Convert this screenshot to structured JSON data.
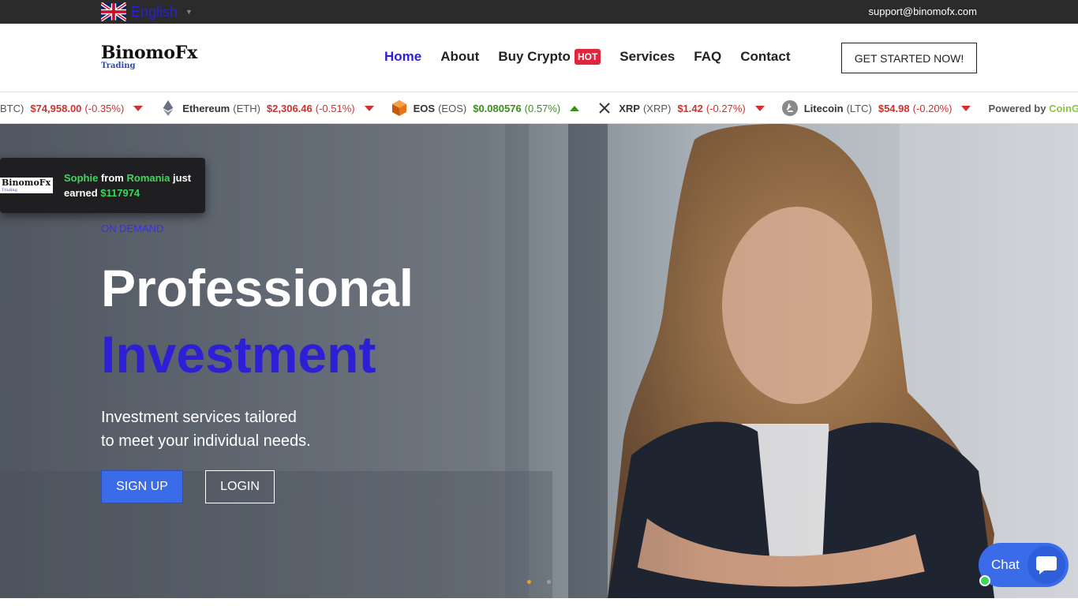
{
  "topbar": {
    "language": "English",
    "support_email": "support@binomofx.com"
  },
  "brand": {
    "name": "BinomoFx",
    "tagline": "Trading"
  },
  "nav": {
    "items": [
      {
        "label": "Home",
        "active": true
      },
      {
        "label": "About"
      },
      {
        "label": "Buy Crypto",
        "badge": "HOT"
      },
      {
        "label": "Services"
      },
      {
        "label": "FAQ"
      },
      {
        "label": "Contact"
      }
    ],
    "cta": "GET STARTED NOW!"
  },
  "ticker": {
    "items": [
      {
        "name": "",
        "symbol": "BTC)",
        "price": "$74,958.00",
        "change": "(-0.35%)",
        "direction": "down",
        "icon": "bitcoin-icon"
      },
      {
        "name": "Ethereum",
        "symbol": "(ETH)",
        "price": "$2,306.46",
        "change": "(-0.51%)",
        "direction": "down",
        "icon": "ethereum-icon"
      },
      {
        "name": "EOS",
        "symbol": "(EOS)",
        "price": "$0.080576",
        "change": "(0.57%)",
        "direction": "up",
        "icon": "eos-icon"
      },
      {
        "name": "XRP",
        "symbol": "(XRP)",
        "price": "$1.42",
        "change": "(-0.27%)",
        "direction": "down",
        "icon": "xrp-icon"
      },
      {
        "name": "Litecoin",
        "symbol": "(LTC)",
        "price": "$54.98",
        "change": "(-0.20%)",
        "direction": "down",
        "icon": "litecoin-icon"
      }
    ],
    "powered_prefix": "Powered by",
    "powered_brand": "CoinGeck"
  },
  "hero": {
    "eyebrow": "ON DEMAND",
    "title_line1": "Professional",
    "title_line2": "Investment",
    "subtitle_line1": "Investment services tailored",
    "subtitle_line2": "to meet your individual needs.",
    "signup": "SIGN UP",
    "login": "LOGIN"
  },
  "notification": {
    "logo_name": "BinomoFx",
    "logo_tagline": "Trading",
    "person": "Sophie",
    "from": "from",
    "country": "Romania",
    "mid": "just earned",
    "amount": "$117974"
  },
  "chat": {
    "label": "Chat"
  },
  "colors": {
    "accent": "#2d1fd6",
    "button_blue": "#3a6be8",
    "negative": "#d0312d",
    "positive": "#3a8f1c",
    "highlight_green": "#3ed65a"
  }
}
